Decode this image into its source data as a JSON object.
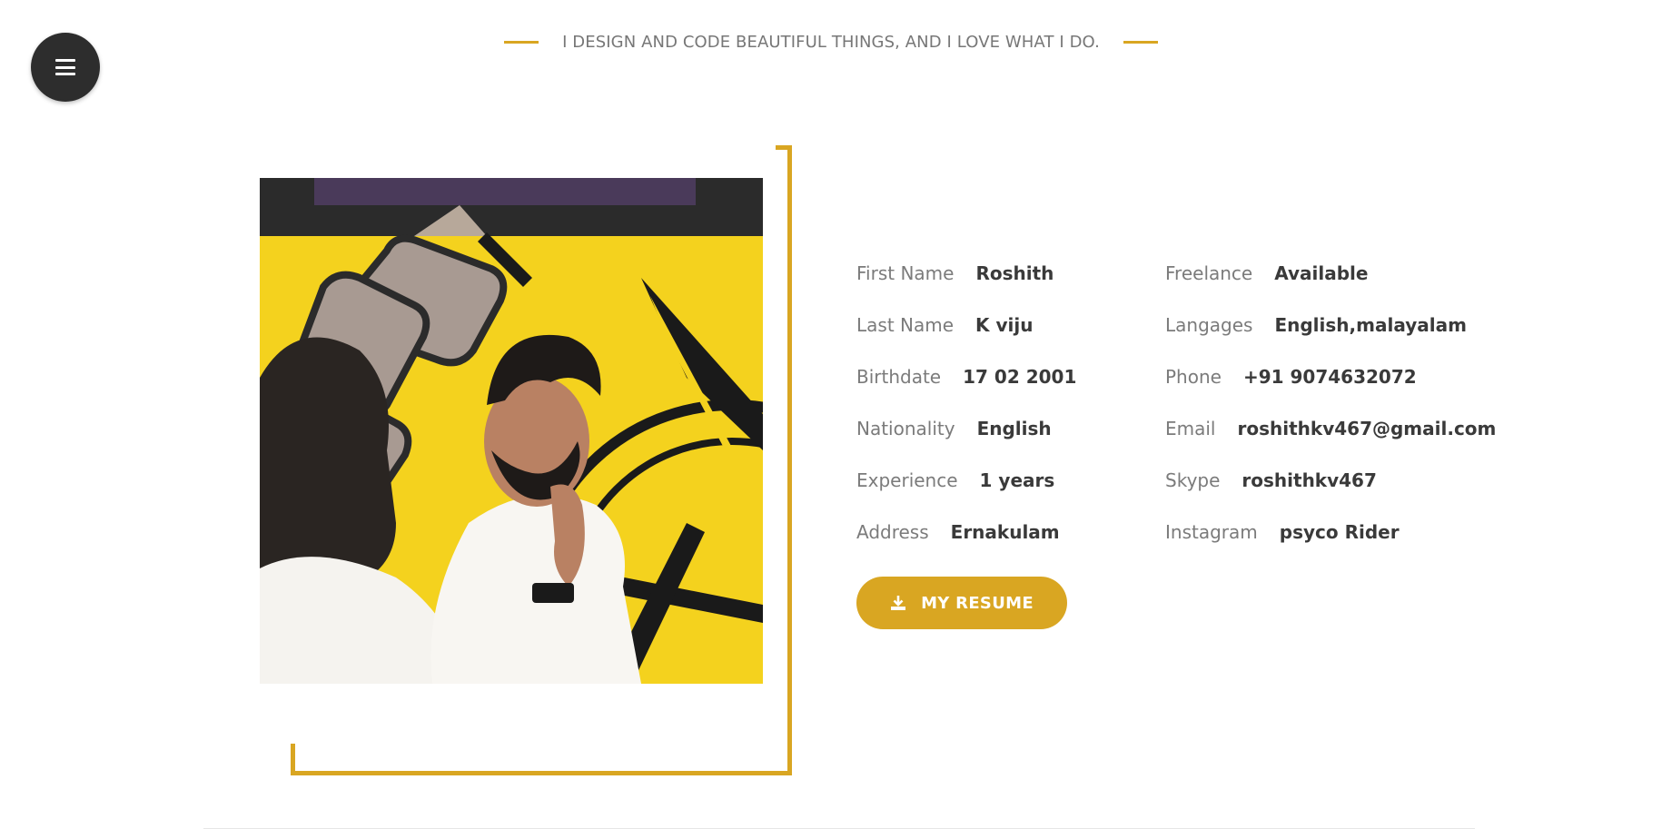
{
  "tagline": "I DESIGN AND CODE BEAUTIFUL THINGS, AND I LOVE WHAT I DO.",
  "colors": {
    "accent": "#d9a622",
    "menu_bg": "#2d2d2d",
    "label": "#7b7b7b",
    "value": "#3a3a3a"
  },
  "icons": {
    "menu": "hamburger-icon",
    "resume": "download-icon"
  },
  "info_left": [
    {
      "label": "First Name",
      "value": "Roshith"
    },
    {
      "label": "Last Name",
      "value": "K viju"
    },
    {
      "label": "Birthdate",
      "value": "17 02 2001"
    },
    {
      "label": "Nationality",
      "value": "English"
    },
    {
      "label": "Experience",
      "value": "1 years"
    },
    {
      "label": "Address",
      "value": "Ernakulam"
    }
  ],
  "info_right": [
    {
      "label": "Freelance",
      "value": "Available"
    },
    {
      "label": "Langages",
      "value": "English,malayalam"
    },
    {
      "label": "Phone",
      "value": "+91 9074632072"
    },
    {
      "label": "Email",
      "value": "roshithkv467@gmail.com"
    },
    {
      "label": "Skype",
      "value": "roshithkv467"
    },
    {
      "label": "Instagram",
      "value": "psyco Rider"
    }
  ],
  "resume_button": "MY RESUME"
}
